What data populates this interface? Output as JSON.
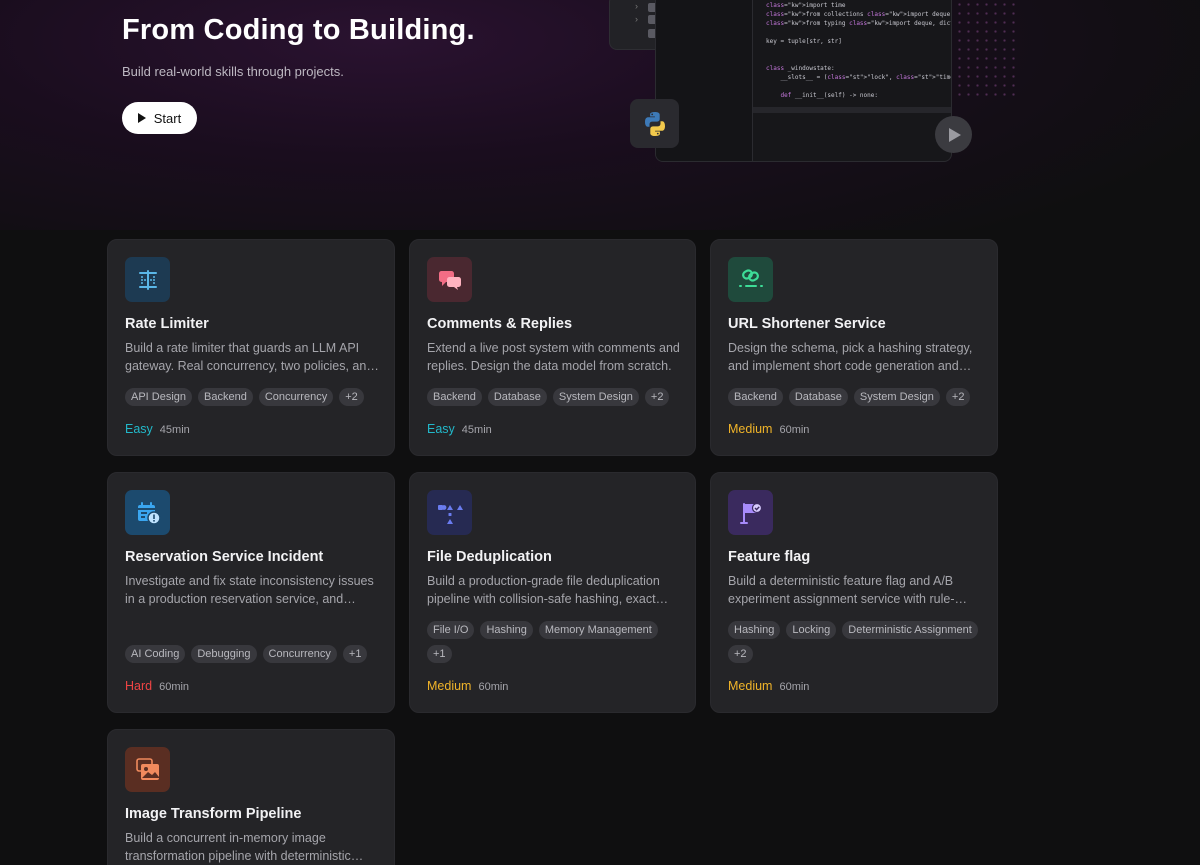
{
  "hero": {
    "title": "From Coding to Building.",
    "subtitle": "Build real-world skills through projects.",
    "start_label": "Start",
    "code_lines": [
      "import time",
      "from collections import deque",
      "from typing import deque, dict, tuple",
      "",
      "key = tuple[str, str]",
      "",
      "",
      "class _windowstate:",
      "    __slots__ = (\"lock\", \"timestamps\")",
      "",
      "    def __init__(self) -> none:"
    ]
  },
  "colors": {
    "easy": "#22b8c9",
    "medium": "#f0b429",
    "hard": "#ef4444"
  },
  "cards": [
    {
      "title": "Rate Limiter",
      "description": "Build a rate limiter that guards an LLM API gateway. Real concurrency, two policies, and strict correctness under load.",
      "tags": [
        "API Design",
        "Backend",
        "Concurrency",
        "+2"
      ],
      "difficulty": "Easy",
      "duration": "45min",
      "icon": "rate-limiter-icon"
    },
    {
      "title": "Comments & Replies",
      "description": "Extend a live post system with comments and replies. Design the data model from scratch.",
      "tags": [
        "Backend",
        "Database",
        "System Design",
        "+2"
      ],
      "difficulty": "Easy",
      "duration": "45min",
      "icon": "chat-bubbles-icon"
    },
    {
      "title": "URL Shortener Service",
      "description": "Design the schema, pick a hashing strategy, and implement short code generation and redirects.",
      "tags": [
        "Backend",
        "Database",
        "System Design",
        "+2"
      ],
      "difficulty": "Medium",
      "duration": "60min",
      "icon": "link-icon"
    },
    {
      "title": "Reservation Service Incident",
      "description": "Investigate and fix state inconsistency issues in a production reservation service, and restore correctness.",
      "tags": [
        "AI Coding",
        "Debugging",
        "Concurrency",
        "+1"
      ],
      "difficulty": "Hard",
      "duration": "60min",
      "icon": "calendar-alert-icon"
    },
    {
      "title": "File Deduplication",
      "description": "Build a production-grade file deduplication pipeline with collision-safe hashing, exact matching and reporting.",
      "tags": [
        "File I/O",
        "Hashing",
        "Memory Management",
        "+1"
      ],
      "difficulty": "Medium",
      "duration": "60min",
      "icon": "shapes-dedupe-icon"
    },
    {
      "title": "Feature flag",
      "description": "Build a deterministic feature flag and A/B experiment assignment service with rule-based targeting.",
      "tags": [
        "Hashing",
        "Locking",
        "Deterministic Assignment",
        "+2"
      ],
      "difficulty": "Medium",
      "duration": "60min",
      "icon": "flag-icon"
    },
    {
      "title": "Image Transform Pipeline",
      "description": "Build a concurrent in-memory image transformation pipeline with deterministic output ordering.",
      "tags": [],
      "difficulty": "",
      "duration": "",
      "icon": "image-icon"
    }
  ]
}
